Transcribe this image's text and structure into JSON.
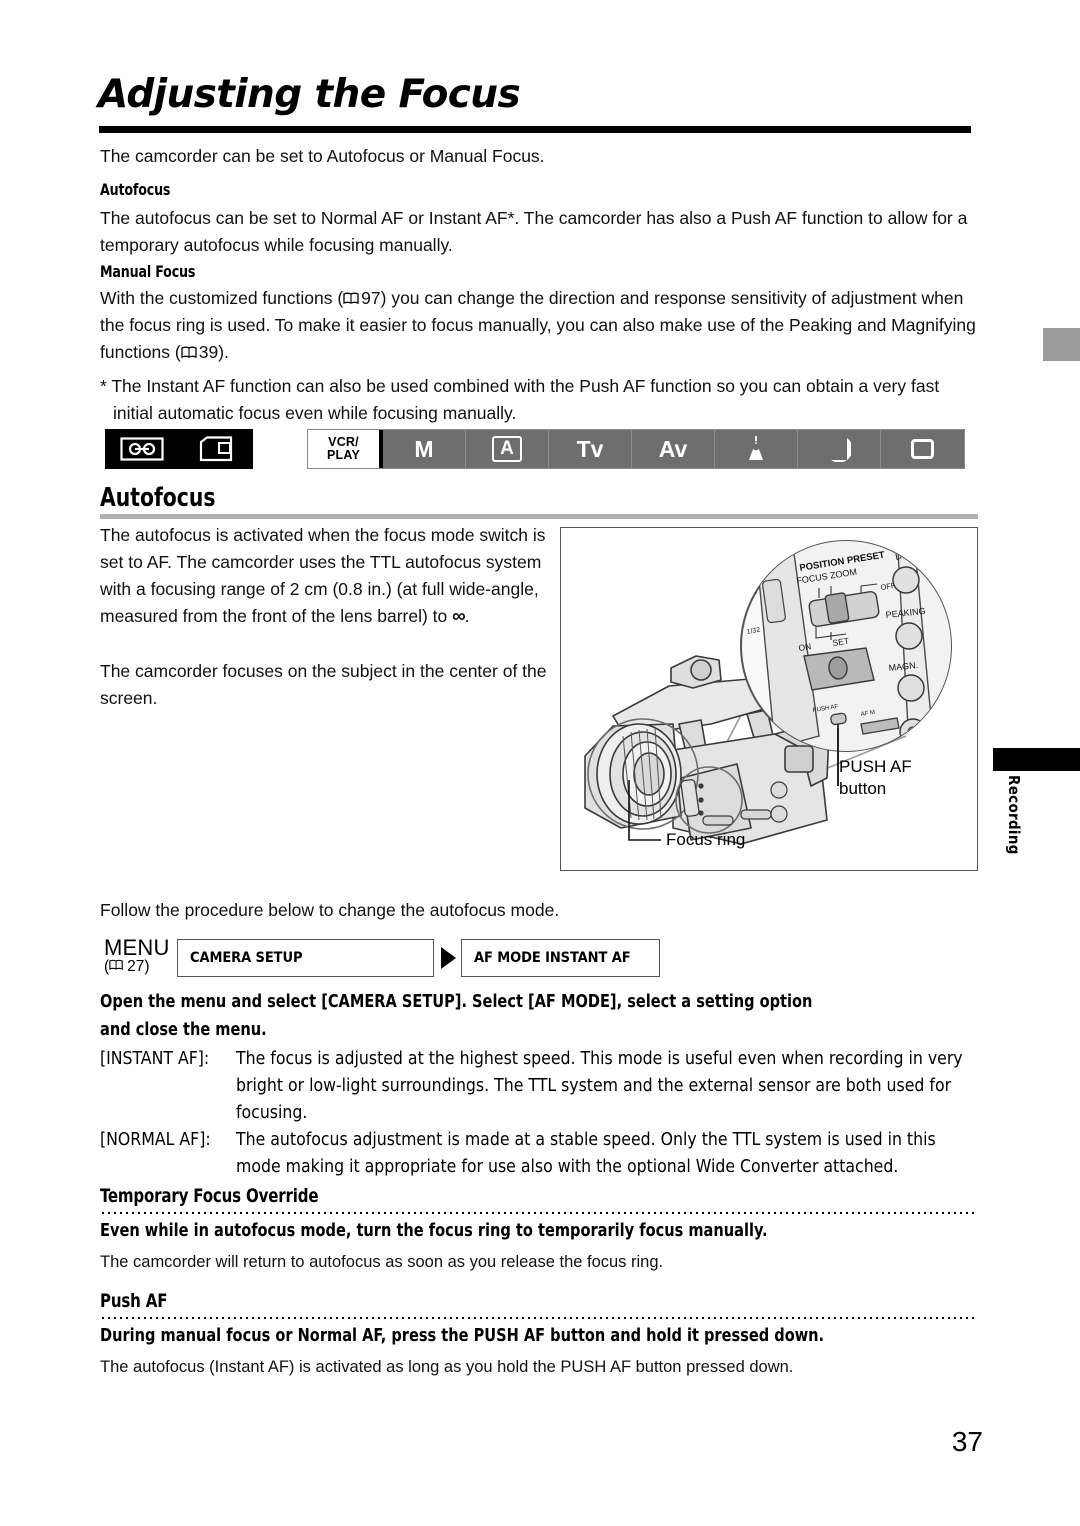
{
  "page": {
    "title": "Adjusting the Focus",
    "page_number": "37",
    "side_tab_label": "Recording"
  },
  "intro": {
    "line": "The camcorder can be set to Autofocus or Manual Focus."
  },
  "autofocus_intro": {
    "heading": "Autofocus",
    "paragraph": "The autofocus can be set to Normal AF or Instant AF*. The camcorder has also a Push AF function to allow for a temporary autofocus while focusing manually."
  },
  "manual_focus": {
    "heading": "Manual Focus",
    "para_part1": "With the customized functions (",
    "ref1_page": "97",
    "para_part2": ") you can change the direction and response sensitivity of adjustment when the focus ring is used. To make it easier to focus manually, you can also make use of the Peaking and Magnifying functions (",
    "ref2_page": "39",
    "para_part3": ")."
  },
  "footnote": {
    "line1": "* The Instant AF function can also be used combined with the Push AF function so you can obtain a very fast",
    "line2": "initial automatic focus even while focusing manually."
  },
  "media_icons": [
    {
      "name": "tape-cassette-icon",
      "label": "Tape"
    },
    {
      "name": "memory-card-icon",
      "label": "Card"
    }
  ],
  "mode_bar": {
    "cells": [
      {
        "name": "mode-vcr-play",
        "label": "VCR/\nPLAY",
        "label_line1": "VCR/",
        "label_line2": "PLAY",
        "active": true,
        "type": "text"
      },
      {
        "name": "mode-m",
        "label": "M",
        "type": "text"
      },
      {
        "name": "mode-a",
        "label": "A",
        "type": "boxed"
      },
      {
        "name": "mode-tv",
        "label": "Tv",
        "type": "text"
      },
      {
        "name": "mode-av",
        "label": "Av",
        "type": "text"
      },
      {
        "name": "mode-spotlight",
        "label": "",
        "type": "spotlight"
      },
      {
        "name": "mode-night",
        "label": "",
        "type": "moon"
      },
      {
        "name": "mode-easy",
        "label": "",
        "type": "rect"
      }
    ]
  },
  "autofocus_section": {
    "heading": "Autofocus",
    "para1_a": "The autofocus is activated when the focus mode switch is set to AF. The camcorder uses the TTL autofocus system with a focusing range of 2 cm (0.8 in.) (at full wide-angle, measured from the front of the lens barrel) to ",
    "para1_infinity": "∞",
    "para1_b": ".",
    "para2": "The camcorder focuses on the subject in the center of the screen.",
    "follow_line": "Follow the procedure below to change the autofocus mode."
  },
  "illustration": {
    "callout_push_af_line1": "PUSH AF",
    "callout_push_af_line2": "button",
    "callout_focus_ring": "Focus ring",
    "zoom_labels": {
      "position_preset": "POSITION PRESET",
      "focus_zoom": "FOCUS ZOOM",
      "off": "OFF",
      "on": "ON",
      "set": "SET",
      "disp": "DISP.",
      "peaking": "PEAKING",
      "magn": "MAGN."
    }
  },
  "menu": {
    "label": "MENU",
    "page_ref": "27",
    "step1": "CAMERA SETUP",
    "step2": "AF MODE  INSTANT AF"
  },
  "instruction": {
    "line1": "Open the menu and select [CAMERA SETUP]. Select [AF MODE], select a setting option",
    "line2": "and close the menu."
  },
  "options": [
    {
      "label": "[INSTANT AF]:",
      "text": "The focus is adjusted at the highest speed. This mode is useful even when recording in very bright or low-light surroundings. The TTL system and the external sensor are both used for focusing."
    },
    {
      "label": "[NORMAL AF]:",
      "text": "The autofocus adjustment is made at a stable speed. Only the TTL system is used in this mode making it appropriate for use also with the optional Wide Converter attached."
    }
  ],
  "temporary_focus_override": {
    "heading": "Temporary Focus Override",
    "bold_line": "Even while in autofocus mode, turn the focus ring to temporarily focus manually.",
    "body": "The camcorder will return to autofocus as soon as you release the focus ring."
  },
  "push_af": {
    "heading": "Push AF",
    "bold_line": "During manual focus or Normal AF, press the PUSH AF button and hold it pressed down.",
    "body": "The autofocus (Instant AF) is activated as long as you hold the PUSH AF button pressed down."
  },
  "colors": {
    "mode_bar_gray": "#6e6e6e",
    "rule_gray": "#b0b0b0",
    "tab_gray": "#9b9b9b",
    "black": "#000000"
  }
}
